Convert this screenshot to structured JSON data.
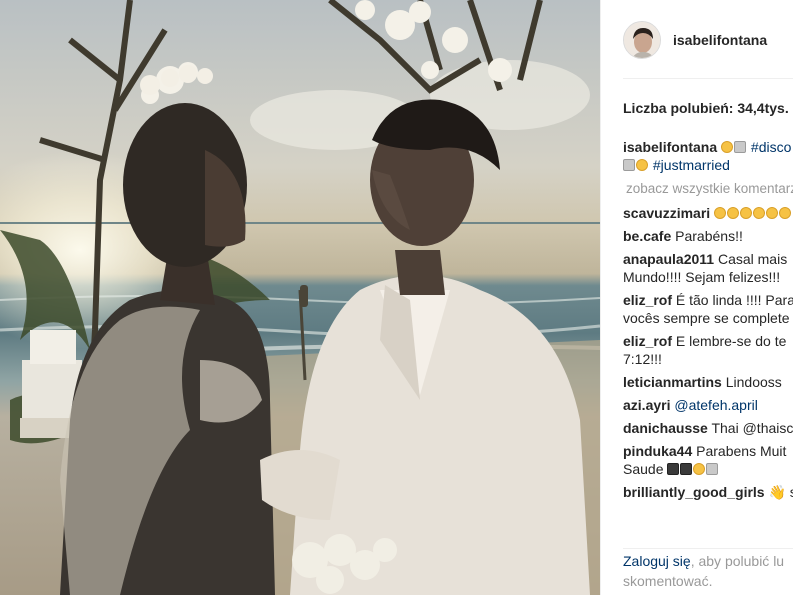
{
  "post": {
    "photo_alt": "",
    "username": "isabelifontana",
    "likes_text": "Liczba polubień: 34,4tys."
  },
  "caption": {
    "username": "isabelifontana",
    "hashtag_disc": "#disco",
    "hashtag_married": "#justmarried",
    "view_all": "zobacz wszystkie komentarze"
  },
  "comments": [
    {
      "user": "scavuzzimari",
      "text": "",
      "emoji": [
        "face",
        "face",
        "face",
        "face",
        "face",
        "face"
      ]
    },
    {
      "user": "be.cafe",
      "text": "Parabéns!!"
    },
    {
      "user": "anapaula2011",
      "text": "Casal mais",
      "text2": "Mundo!!!! Sejam felizes!!!"
    },
    {
      "user": "eliz_rof",
      "text": "É tão linda !!!! Para",
      "text2": "vocês sempre se complete"
    },
    {
      "user": "eliz_rof",
      "text": "E lembre-se do te",
      "text2": "7:12!!!"
    },
    {
      "user": "leticianmartins",
      "text": "Lindooss"
    },
    {
      "user": "azi.ayri",
      "text": "@atefeh.april"
    },
    {
      "user": "danichausse",
      "text": "Thai @thaisc"
    },
    {
      "user": "pinduka44",
      "text": "Parabens Muit",
      "text2": "Saude"
    },
    {
      "user": "brilliantly_good_girls",
      "text": "👋 s"
    }
  ],
  "login": {
    "link": "Zaloguj się",
    "rest1": ", aby polubić lu",
    "rest2": "skomentować."
  },
  "colors": {
    "link": "#003569",
    "text": "#262626",
    "muted": "#999999"
  }
}
